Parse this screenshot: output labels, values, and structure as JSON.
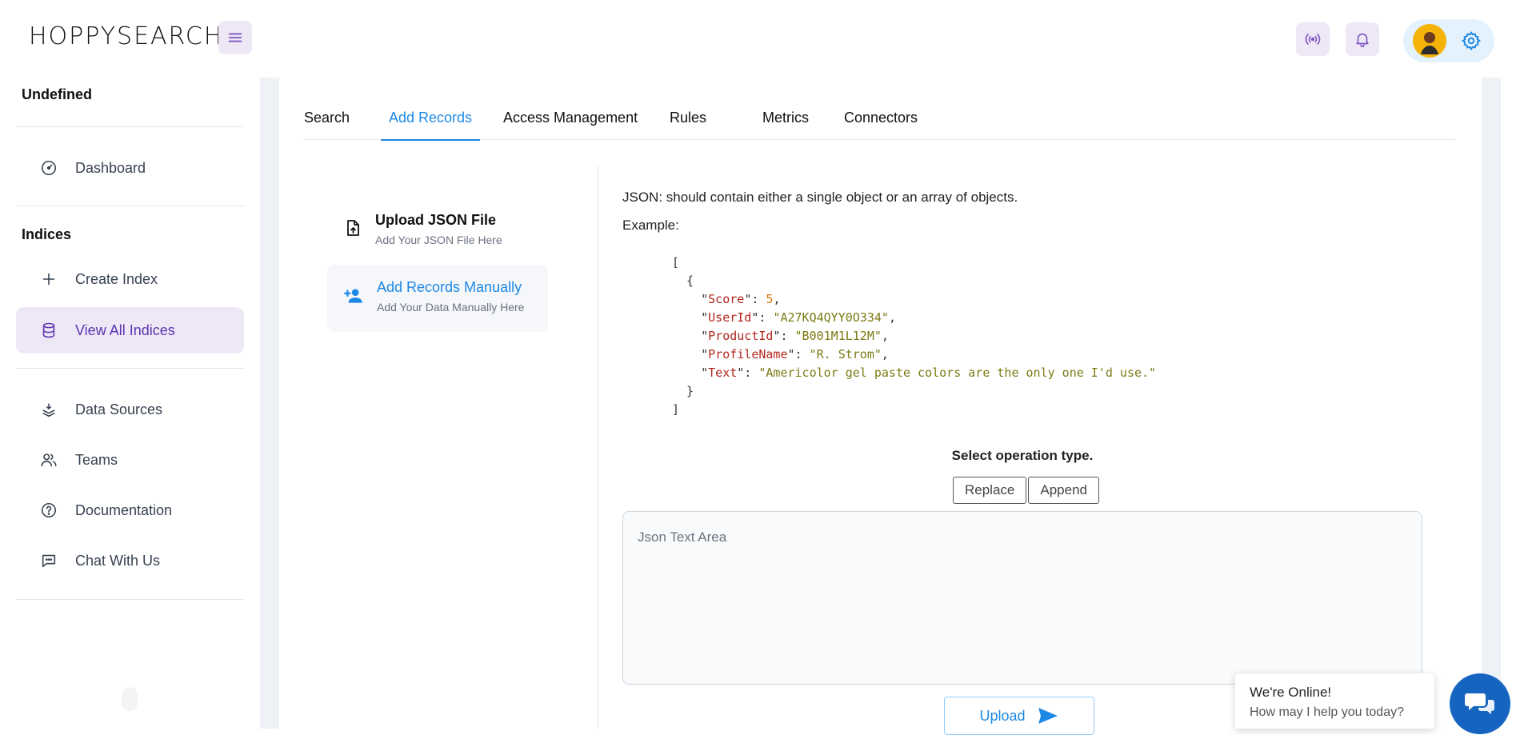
{
  "app": {
    "logo": "HOPPYSEARCH"
  },
  "sidebar": {
    "org_name": "Undefined",
    "section_indices": "Indices",
    "items": [
      {
        "label": "Dashboard",
        "icon": "dashboard-icon"
      },
      {
        "label": "Create Index",
        "icon": "plus-icon"
      },
      {
        "label": "View All Indices",
        "icon": "database-icon",
        "active": true
      },
      {
        "label": "Data Sources",
        "icon": "layers-icon"
      },
      {
        "label": "Teams",
        "icon": "users-icon"
      },
      {
        "label": "Documentation",
        "icon": "help-icon"
      },
      {
        "label": "Chat With Us",
        "icon": "chat-icon"
      }
    ]
  },
  "tabs": [
    {
      "label": "Search"
    },
    {
      "label": "Add Records",
      "active": true
    },
    {
      "label": "Access Management"
    },
    {
      "label": "Rules"
    },
    {
      "label": "Metrics"
    },
    {
      "label": "Connectors"
    }
  ],
  "options": [
    {
      "title": "Upload JSON File",
      "subtitle": "Add Your JSON File Here",
      "icon": "file-upload-icon"
    },
    {
      "title": "Add Records Manually",
      "subtitle": "Add Your Data Manually Here",
      "icon": "person-add-icon",
      "active": true
    }
  ],
  "content": {
    "description": "JSON: should contain either a single object or an array of objects.",
    "example_label": "Example:",
    "example": {
      "Score": "5",
      "UserId": "\"A27KQ4QYY0O334\"",
      "ProductId": "\"B001M1L12M\"",
      "ProfileName": "\"R. Strom\"",
      "Text": "\"Americolor gel paste colors are the only one I'd use.\""
    },
    "operation_label": "Select operation type.",
    "replace_label": "Replace",
    "append_label": "Append",
    "textarea_placeholder": "Json Text Area",
    "upload_label": "Upload"
  },
  "chat": {
    "title": "We're Online!",
    "subtitle": "How may I help you today?"
  },
  "colors": {
    "accent": "#1e88e5",
    "purple": "#5e35b1",
    "purple_bg": "#ede7f6"
  }
}
